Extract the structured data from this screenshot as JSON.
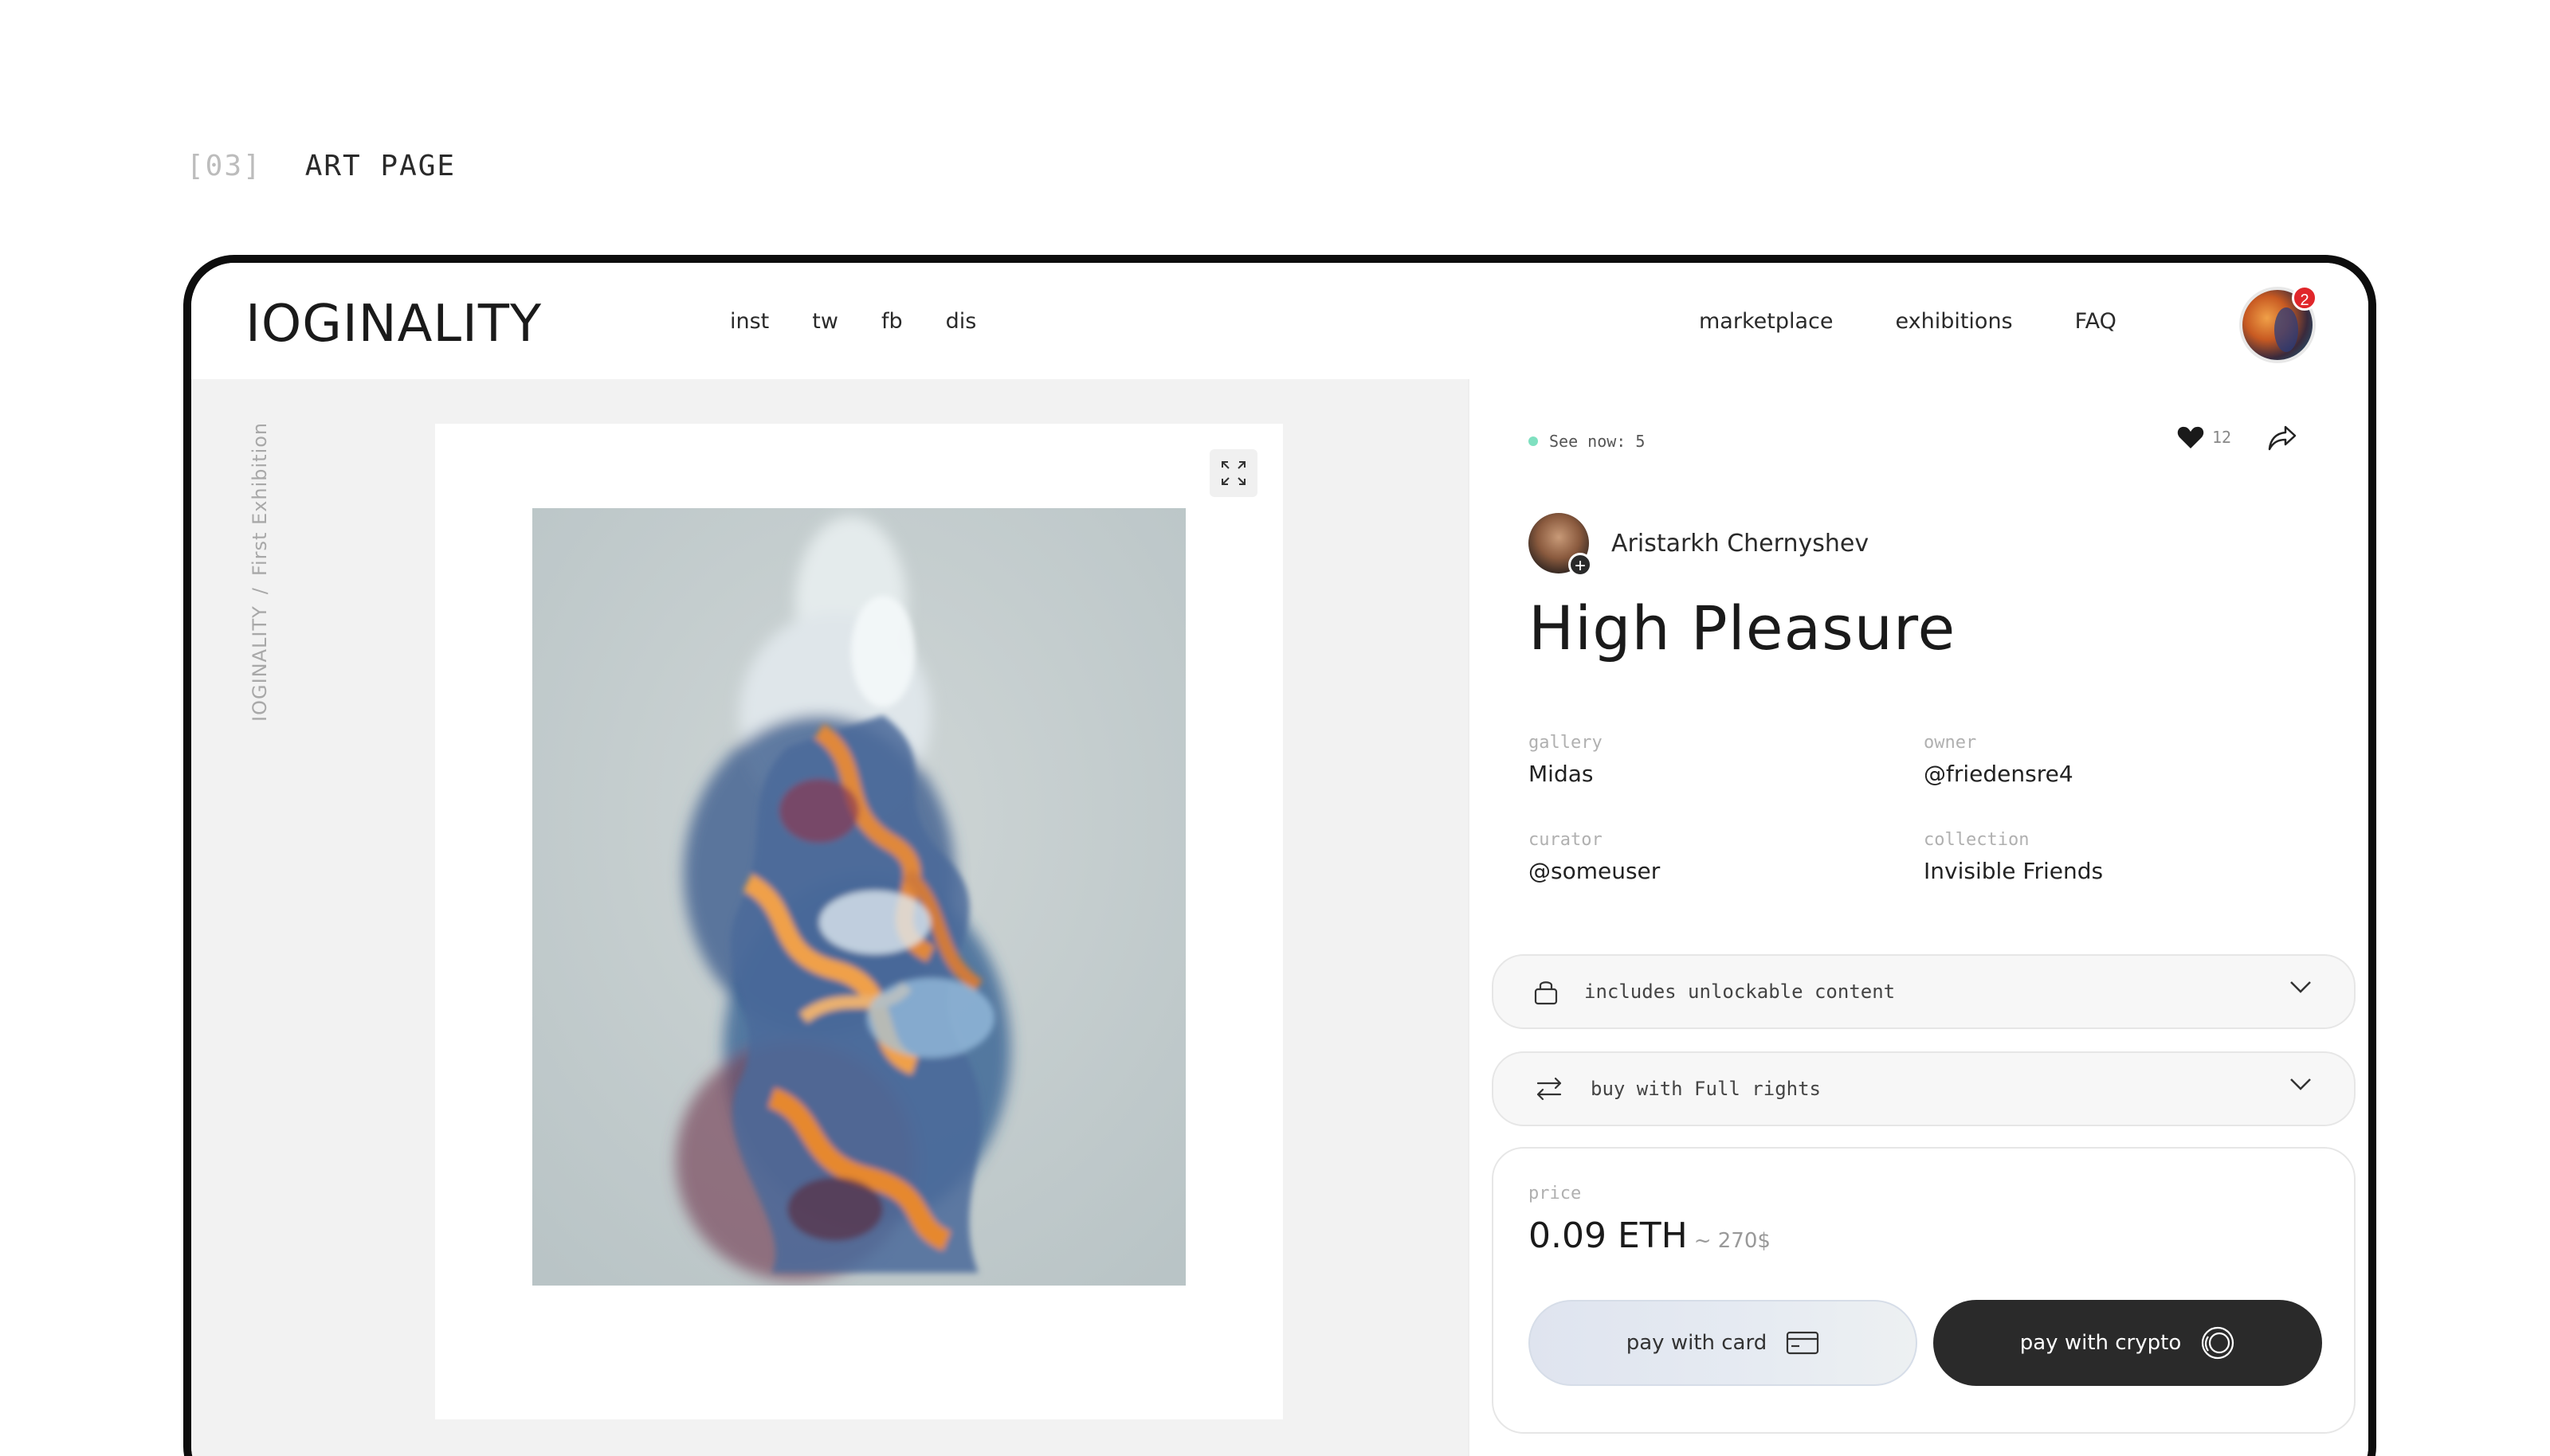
{
  "section": {
    "number": "[03]",
    "title": "ART PAGE"
  },
  "header": {
    "logo": "IOGINALITY",
    "social": [
      "inst",
      "tw",
      "fb",
      "dis"
    ],
    "nav": [
      "marketplace",
      "exhibitions",
      "FAQ"
    ],
    "notification_count": "2"
  },
  "breadcrumb": {
    "site": "IOGINALITY",
    "separator": "/",
    "page": "First Exhibition"
  },
  "details": {
    "viewers_label": "See now: 5",
    "likes": "12",
    "author": "Aristarkh Chernyshev",
    "title": "High Pleasure",
    "meta": [
      {
        "key": "gallery",
        "value": "Midas"
      },
      {
        "key": "owner",
        "value": "@friedensre4"
      },
      {
        "key": "curator",
        "value": "@someuser"
      },
      {
        "key": "collection",
        "value": "Invisible Friends"
      }
    ],
    "unlockable_label": "includes unlockable content",
    "rights_label": "buy with Full rights",
    "price_label": "price",
    "price_value": "0.09 ETH",
    "price_usd": "~ 270$",
    "pay_card_label": "pay with card",
    "pay_crypto_label": "pay with crypto"
  },
  "colors": {
    "frame": "#0d0d0d",
    "accent_dark": "#2a2a2a",
    "badge": "#e0262a",
    "online_dot": "#7fe0c0"
  }
}
